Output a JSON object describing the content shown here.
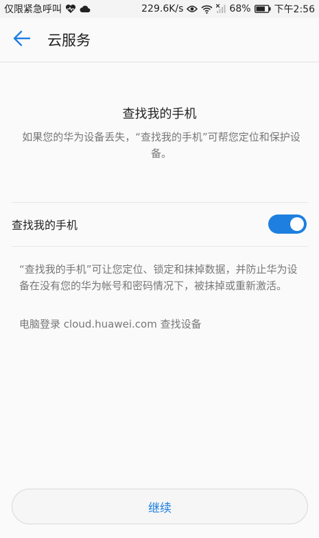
{
  "status_bar": {
    "carrier": "仅限紧急呼叫",
    "speed": "229.6K/s",
    "battery": "68%",
    "time": "下午2:56",
    "icons": [
      "heartbeat-icon",
      "cloud-icon",
      "eye-icon",
      "wifi-icon",
      "signal-icon",
      "battery-icon"
    ]
  },
  "header": {
    "back_icon": "back-arrow-icon",
    "title": "云服务"
  },
  "main": {
    "heading": "查找我的手机",
    "description": "如果您的华为设备丢失，“查找我的手机”可帮您定位和保护设备。",
    "toggle": {
      "label": "查找我的手机",
      "state": "on"
    },
    "info": "“查找我的手机”可让您定位、锁定和抹掉数据，并防止华为设备在没有您的华为帐号和密码情况下，被抹掉或重新激活。",
    "login_hint": "电脑登录 cloud.huawei.com 查找设备"
  },
  "footer": {
    "continue_label": "继续"
  },
  "colors": {
    "accent": "#1e7fe0",
    "background": "#fafafa",
    "secondary_text": "#777777"
  }
}
